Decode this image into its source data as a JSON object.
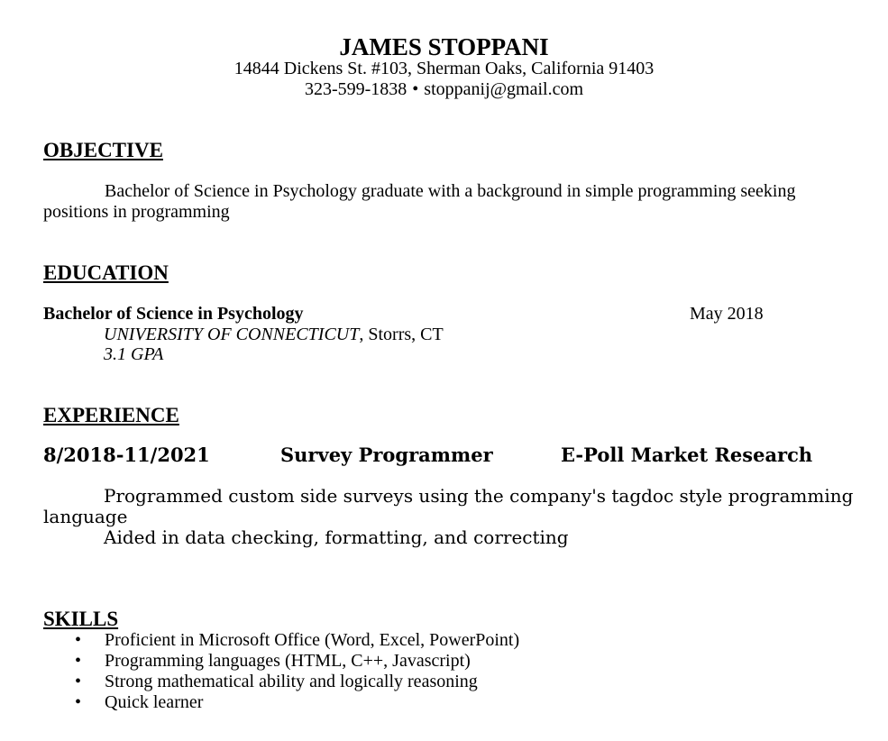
{
  "header": {
    "name": "JAMES STOPPANI",
    "address": "14844 Dickens St. #103, Sherman Oaks, California 91403",
    "phone": "323-599-1838",
    "separator": "•",
    "email": "stoppanij@gmail.com"
  },
  "objective": {
    "heading": "OBJECTIVE",
    "text": "Bachelor of Science in Psychology graduate with a background in simple programming seeking positions in programming"
  },
  "education": {
    "heading": "EDUCATION",
    "degree": "Bachelor of Science in Psychology",
    "date": "May 2018",
    "school": "UNIVERSITY OF CONNECTICUT",
    "location": ", Storrs, CT",
    "gpa": "3.1 GPA"
  },
  "experience": {
    "heading": "EXPERIENCE",
    "dates": "8/2018-11/2021",
    "title": "Survey Programmer",
    "company": "E-Poll Market Research",
    "duties": [
      "Programmed custom side surveys  using the company's tagdoc style programming language",
      "Aided in data checking, formatting, and correcting"
    ]
  },
  "skills": {
    "heading": "SKILLS",
    "bullet": "•",
    "items": [
      "Proficient in Microsoft Office (Word, Excel, PowerPoint)",
      "Programming languages (HTML, C++, Javascript)",
      "Strong mathematical ability and logically reasoning",
      "Quick learner"
    ]
  }
}
